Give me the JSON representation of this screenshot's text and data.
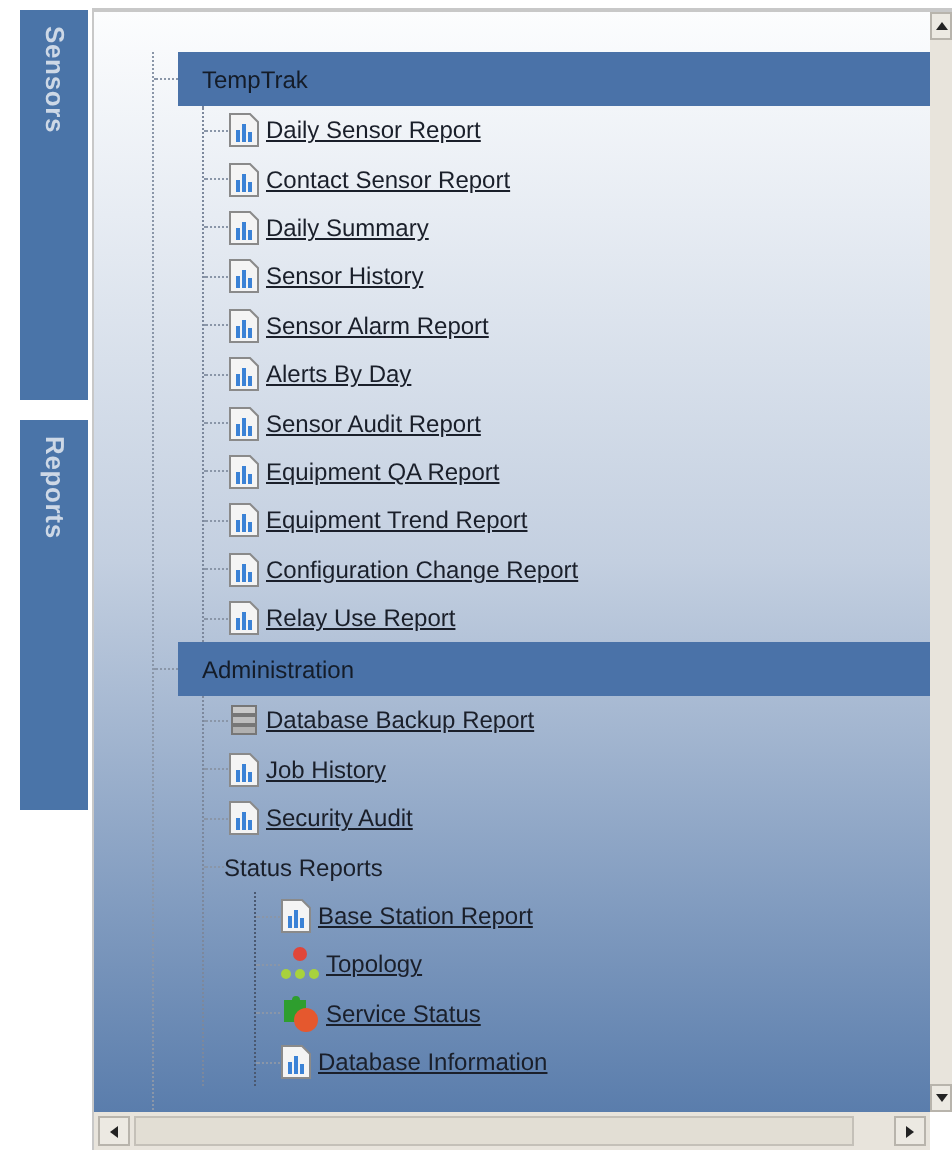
{
  "side_tabs": [
    "Sensors",
    "Reports"
  ],
  "groups": [
    {
      "title": "TempTrak",
      "items": [
        {
          "kind": "report",
          "label": "Daily Sensor Report"
        },
        {
          "kind": "report",
          "label": "Contact Sensor Report"
        },
        {
          "kind": "report",
          "label": "Daily Summary"
        },
        {
          "kind": "report",
          "label": "Sensor History"
        },
        {
          "kind": "report",
          "label": "Sensor Alarm Report"
        },
        {
          "kind": "report",
          "label": "Alerts By Day"
        },
        {
          "kind": "report",
          "label": "Sensor Audit Report"
        },
        {
          "kind": "report",
          "label": "Equipment QA Report"
        },
        {
          "kind": "report",
          "label": "Equipment Trend Report"
        },
        {
          "kind": "report",
          "label": "Configuration Change Report"
        },
        {
          "kind": "report",
          "label": "Relay Use Report"
        }
      ]
    },
    {
      "title": "Administration",
      "items": [
        {
          "kind": "database",
          "label": "Database Backup Report"
        },
        {
          "kind": "report",
          "label": "Job History"
        },
        {
          "kind": "report",
          "label": "Security Audit"
        },
        {
          "kind": "folder",
          "label": "Status Reports",
          "children": [
            {
              "kind": "report",
              "label": "Base Station Report"
            },
            {
              "kind": "topology",
              "label": "Topology"
            },
            {
              "kind": "service",
              "label": "Service Status"
            },
            {
              "kind": "report",
              "label": "Database Information"
            }
          ]
        }
      ]
    }
  ]
}
